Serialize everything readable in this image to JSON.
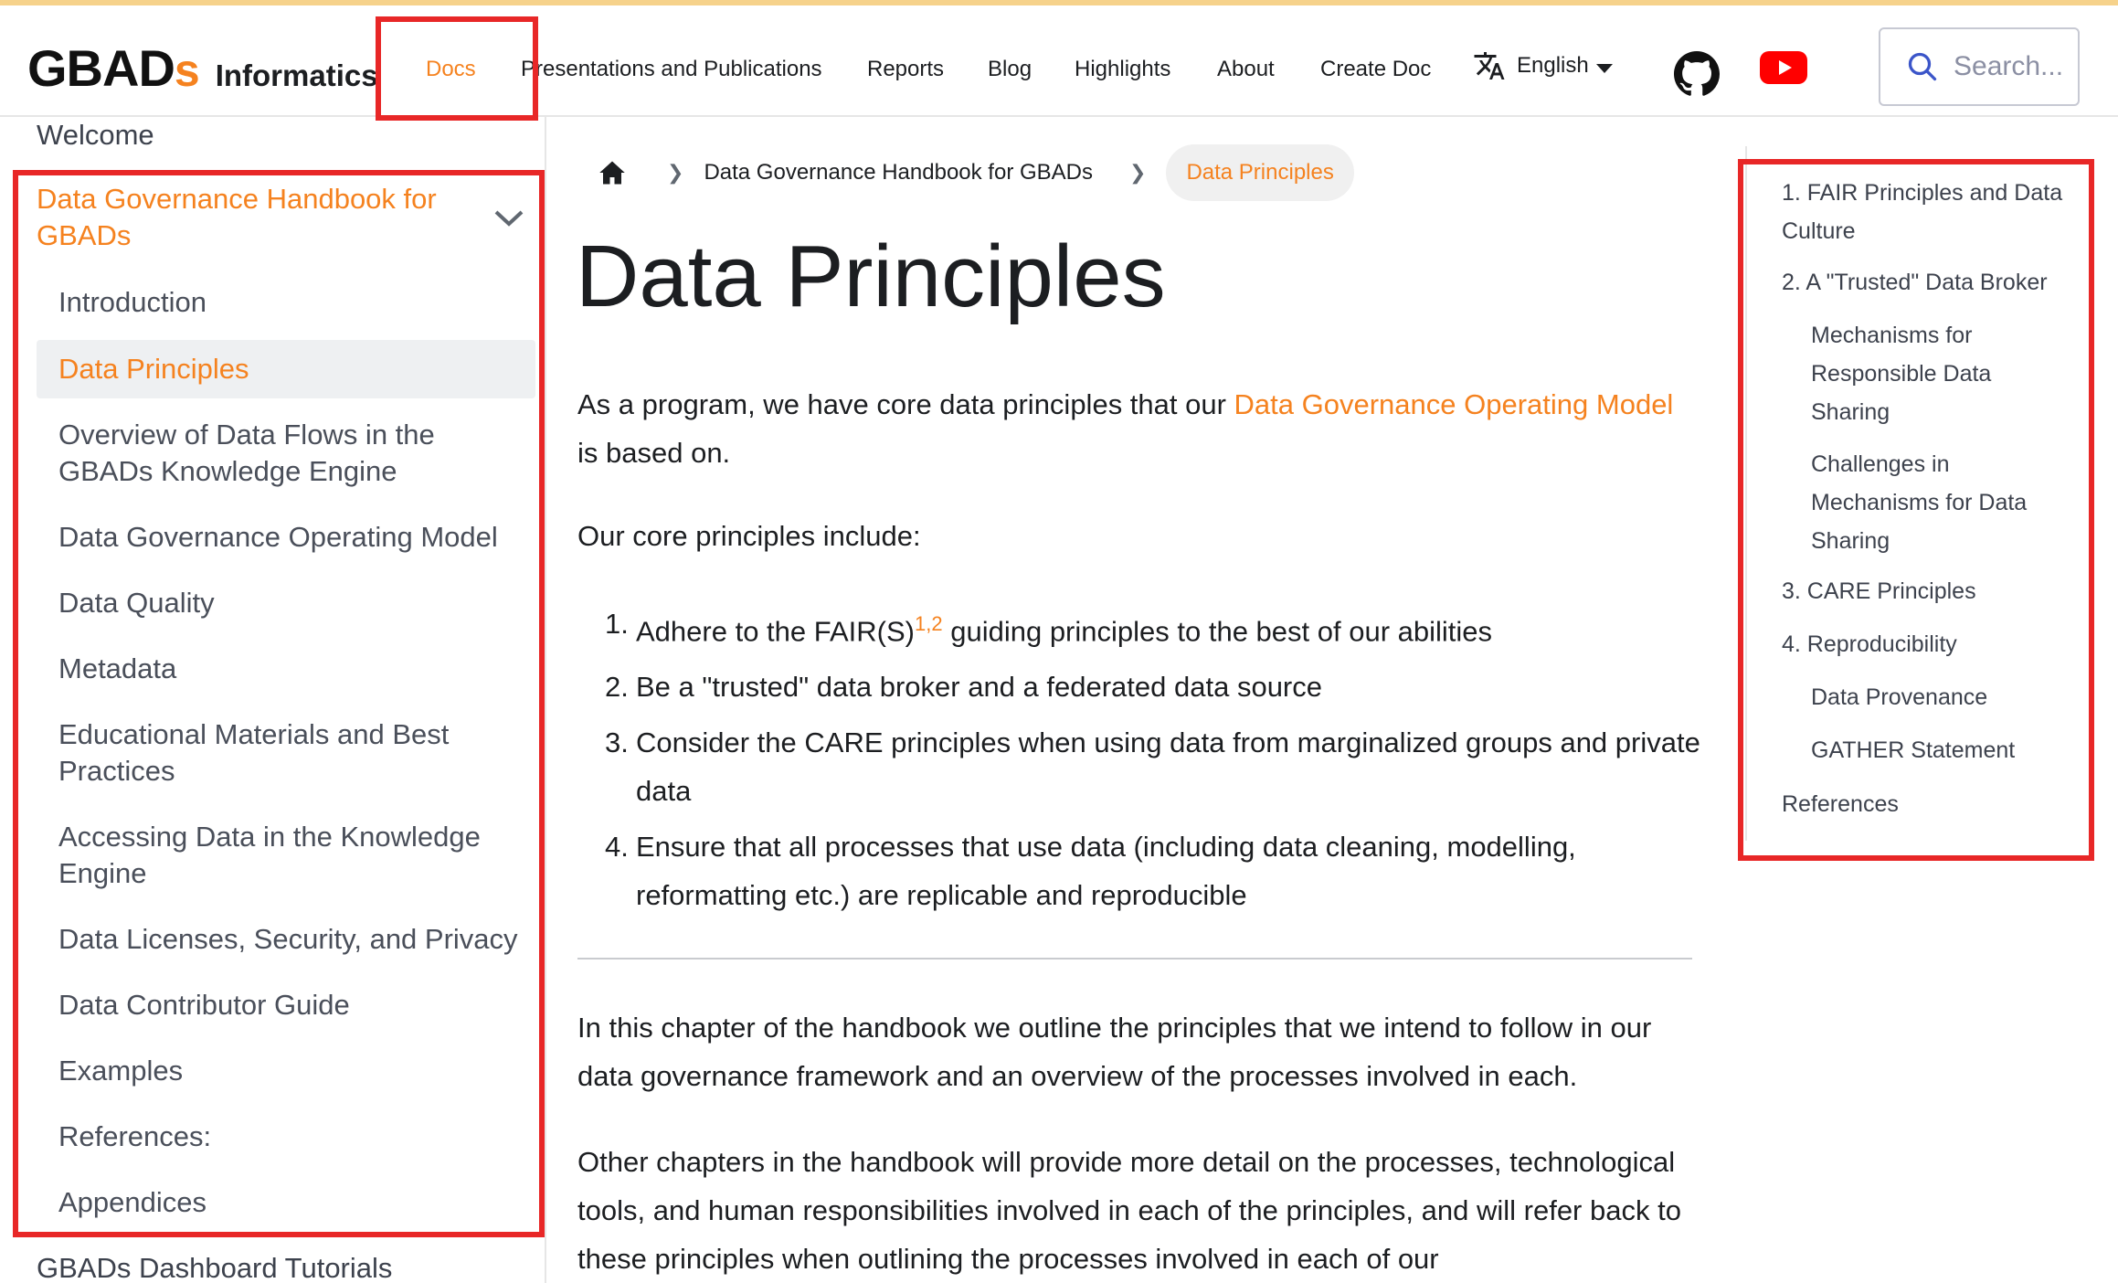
{
  "brand": {
    "logo_main": "GBAD",
    "logo_s": "s",
    "title": "Informatics"
  },
  "nav": {
    "items": [
      "Docs",
      "Presentations and Publications",
      "Reports",
      "Blog",
      "Highlights",
      "About",
      "Create Doc"
    ],
    "language": "English",
    "search_placeholder": "Search..."
  },
  "sidebar": {
    "welcome": "Welcome",
    "category": "Data Governance Handbook for GBADs",
    "items": [
      "Introduction",
      "Data Principles",
      "Overview of Data Flows in the GBADs Knowledge Engine",
      "Data Governance Operating Model",
      "Data Quality",
      "Metadata",
      "Educational Materials and Best Practices",
      "Accessing Data in the Knowledge Engine",
      "Data Licenses, Security, and Privacy",
      "Data Contributor Guide",
      "Examples",
      "References:",
      "Appendices"
    ],
    "active_index": 1,
    "next_category": "GBADs Dashboard Tutorials"
  },
  "breadcrumb": {
    "parent": "Data Governance Handbook for GBADs",
    "current": "Data Principles"
  },
  "main": {
    "title": "Data Principles",
    "intro_before": "As a program, we have core data principles that our ",
    "intro_link": "Data Governance Operating Model",
    "intro_after": " is based on.",
    "principles_heading": "Our core principles include:",
    "list": {
      "item1_before": "Adhere to the FAIR(S)",
      "item1_ref1": "1",
      "item1_comma": ",",
      "item1_ref2": "2",
      "item1_after": " guiding principles to the best of our abilities",
      "item2": "Be a \"trusted\" data broker and a federated data source",
      "item3": "Consider the CARE principles when using data from marginalized groups and private data",
      "item4": "Ensure that all processes that use data (including data cleaning, modelling, reformatting etc.) are replicable and reproducible"
    },
    "para2": "In this chapter of the handbook we outline the principles that we intend to follow in our data governance framework and an overview of the processes involved in each.",
    "para3": "Other chapters in the handbook will provide more detail on the processes, technological tools, and human responsibilities involved in each of the principles, and will refer back to these principles when outlining the processes involved in each of our"
  },
  "toc": [
    "1. FAIR Principles and Data Culture",
    "2. A \"Trusted\" Data Broker",
    "Mechanisms for Responsible Data Sharing",
    "Challenges in Mechanisms for Data Sharing",
    "3. CARE Principles",
    "4. Reproducibility",
    "Data Provenance",
    "GATHER Statement",
    "References"
  ],
  "colors": {
    "accent": "#f5821f",
    "annotation": "#e82727",
    "youtube": "#ff0000"
  }
}
